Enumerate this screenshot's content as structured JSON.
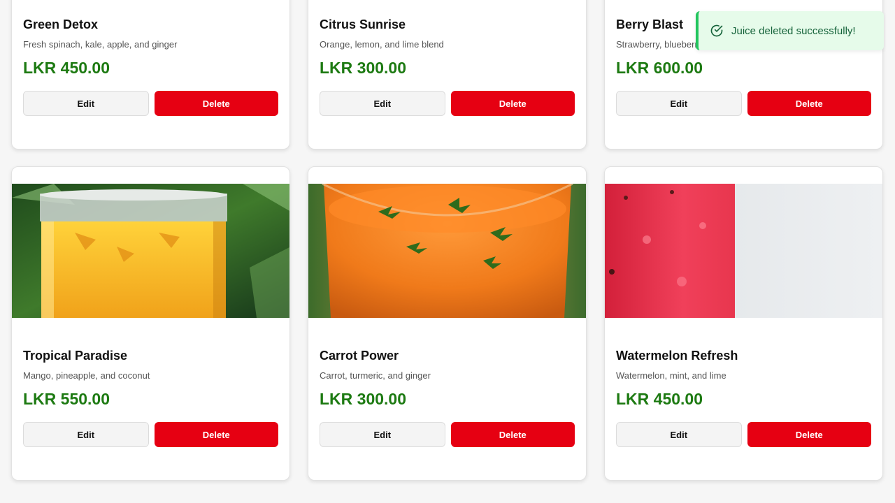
{
  "currency": "LKR",
  "actions": {
    "edit_label": "Edit",
    "delete_label": "Delete"
  },
  "toast": {
    "message": "Juice deleted successfully!",
    "icon": "check-circle-icon",
    "color": "#22c55e"
  },
  "colors": {
    "price": "#1d7a12",
    "delete": "#e60012"
  },
  "juices": [
    {
      "name": "Green Detox",
      "description": "Fresh spinach, kale, apple, and ginger",
      "price": "LKR 450.00",
      "image": ""
    },
    {
      "name": "Citrus Sunrise",
      "description": "Orange, lemon, and lime blend",
      "price": "LKR 300.00",
      "image": ""
    },
    {
      "name": "Berry Blast",
      "description": "Strawberry, blueberry, and raspberry",
      "price": "LKR 600.00",
      "image": ""
    },
    {
      "name": "Tropical Paradise",
      "description": "Mango, pineapple, and coconut",
      "price": "LKR 550.00",
      "image": "mango-juice-image"
    },
    {
      "name": "Carrot Power",
      "description": "Carrot, turmeric, and ginger",
      "price": "LKR 300.00",
      "image": "carrot-juice-image"
    },
    {
      "name": "Watermelon Refresh",
      "description": "Watermelon, mint, and lime",
      "price": "LKR 450.00",
      "image": "watermelon-juice-image"
    }
  ]
}
